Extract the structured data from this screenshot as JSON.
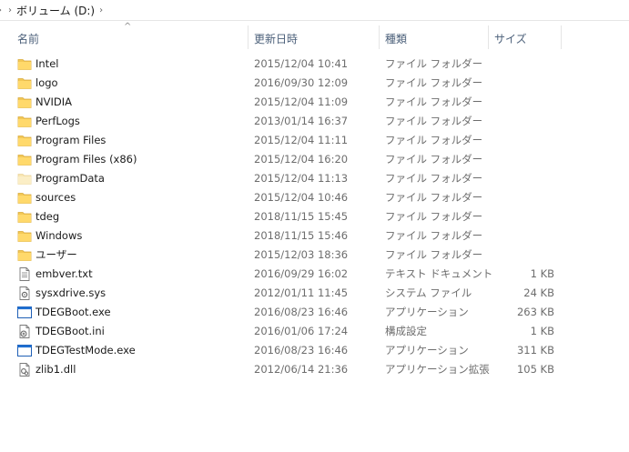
{
  "breadcrumb": {
    "prev_chevron": "›",
    "location": "ボリューム (D:)",
    "chevron": "›"
  },
  "columns": {
    "name": "名前",
    "date": "更新日時",
    "type": "種類",
    "size": "サイズ"
  },
  "sort_indicator": "^",
  "files": [
    {
      "name": "Intel",
      "date": "2015/12/04 10:41",
      "type": "ファイル フォルダー",
      "size": "",
      "icon": "folder-icon"
    },
    {
      "name": "logo",
      "date": "2016/09/30 12:09",
      "type": "ファイル フォルダー",
      "size": "",
      "icon": "folder-icon"
    },
    {
      "name": "NVIDIA",
      "date": "2015/12/04 11:09",
      "type": "ファイル フォルダー",
      "size": "",
      "icon": "folder-icon"
    },
    {
      "name": "PerfLogs",
      "date": "2013/01/14 16:37",
      "type": "ファイル フォルダー",
      "size": "",
      "icon": "folder-icon"
    },
    {
      "name": "Program Files",
      "date": "2015/12/04 11:11",
      "type": "ファイル フォルダー",
      "size": "",
      "icon": "folder-icon"
    },
    {
      "name": "Program Files (x86)",
      "date": "2015/12/04 16:20",
      "type": "ファイル フォルダー",
      "size": "",
      "icon": "folder-icon"
    },
    {
      "name": "ProgramData",
      "date": "2015/12/04 11:13",
      "type": "ファイル フォルダー",
      "size": "",
      "icon": "folder-hidden-icon"
    },
    {
      "name": "sources",
      "date": "2015/12/04 10:46",
      "type": "ファイル フォルダー",
      "size": "",
      "icon": "folder-icon"
    },
    {
      "name": "tdeg",
      "date": "2018/11/15 15:45",
      "type": "ファイル フォルダー",
      "size": "",
      "icon": "folder-icon"
    },
    {
      "name": "Windows",
      "date": "2018/11/15 15:46",
      "type": "ファイル フォルダー",
      "size": "",
      "icon": "folder-icon"
    },
    {
      "name": "ユーザー",
      "date": "2015/12/03 18:36",
      "type": "ファイル フォルダー",
      "size": "",
      "icon": "folder-icon"
    },
    {
      "name": "embver.txt",
      "date": "2016/09/29 16:02",
      "type": "テキスト ドキュメント",
      "size": "1 KB",
      "icon": "text-file-icon"
    },
    {
      "name": "sysxdrive.sys",
      "date": "2012/01/11 11:45",
      "type": "システム ファイル",
      "size": "24 KB",
      "icon": "system-file-icon"
    },
    {
      "name": "TDEGBoot.exe",
      "date": "2016/08/23 16:46",
      "type": "アプリケーション",
      "size": "263 KB",
      "icon": "application-icon"
    },
    {
      "name": "TDEGBoot.ini",
      "date": "2016/01/06 17:24",
      "type": "構成設定",
      "size": "1 KB",
      "icon": "settings-file-icon"
    },
    {
      "name": "TDEGTestMode.exe",
      "date": "2016/08/23 16:46",
      "type": "アプリケーション",
      "size": "311 KB",
      "icon": "application-icon"
    },
    {
      "name": "zlib1.dll",
      "date": "2012/06/14 21:36",
      "type": "アプリケーション拡張",
      "size": "105 KB",
      "icon": "dll-file-icon"
    }
  ]
}
